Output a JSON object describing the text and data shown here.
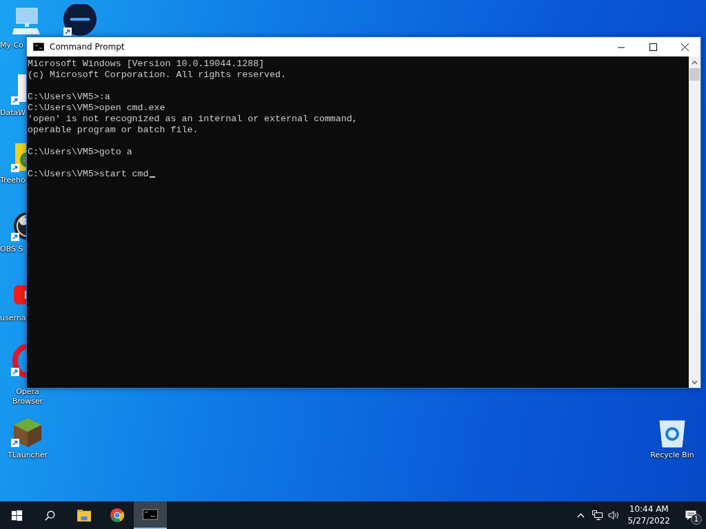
{
  "desktop_icons": [
    {
      "kind": "computer",
      "label": "My Co",
      "shortcut": false
    },
    {
      "kind": "pluto",
      "shortcut": true
    },
    {
      "kind": "document",
      "label": "DataW",
      "shortcut": true
    },
    {
      "kind": "game",
      "label": "Treeho",
      "shortcut": true
    },
    {
      "kind": "obs",
      "label": "OBS S",
      "shortcut": true
    },
    {
      "kind": "youtube",
      "label": "userna",
      "shortcut": false
    },
    {
      "kind": "opera",
      "label": "Opera Browser",
      "shortcut": true
    },
    {
      "kind": "minecraft",
      "label": "TLauncher",
      "shortcut": true
    },
    {
      "kind": "recycle",
      "label": "Recycle Bin",
      "shortcut": false
    }
  ],
  "window": {
    "title": "Command Prompt",
    "cursor_visible": true,
    "console_blocks": [
      [
        "Microsoft Windows [Version 10.0.19044.1288]",
        "(c) Microsoft Corporation. All rights reserved."
      ],
      [
        "C:\\Users\\VM5>:a",
        "C:\\Users\\VM5>open cmd.exe",
        "'open' is not recognized as an internal or external command,",
        "operable program or batch file."
      ],
      [
        "C:\\Users\\VM5>goto a"
      ],
      [
        "C:\\Users\\VM5>start cmd"
      ]
    ]
  },
  "taskbar": {
    "items": [
      {
        "kind": "start",
        "selected": false
      },
      {
        "kind": "search",
        "selected": false
      },
      {
        "kind": "explorer",
        "selected": false
      },
      {
        "kind": "chrome",
        "selected": false
      },
      {
        "kind": "cmd",
        "selected": true
      }
    ],
    "time": "10:44 AM",
    "date": "5/27/2022",
    "notification_count": "1"
  }
}
